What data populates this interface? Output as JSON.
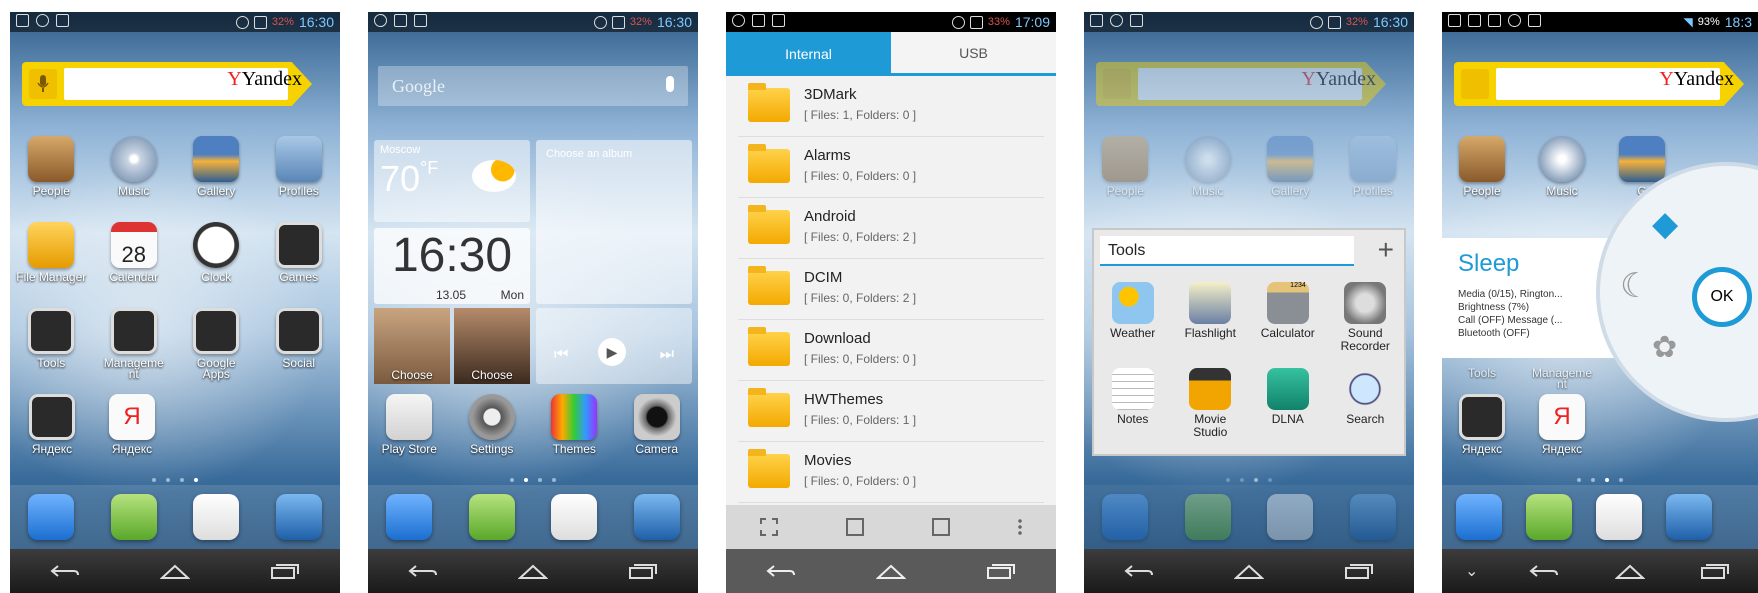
{
  "screens": {
    "s1": {
      "status": {
        "battery_pct": "32%",
        "time": "16:30"
      },
      "yandex_brand": "Yandex",
      "apps_row1": [
        "People",
        "Music",
        "Gallery",
        "Profiles"
      ],
      "apps_row2": [
        "File Manager",
        "Calendar",
        "Clock",
        "Games"
      ],
      "calendar_day": "28",
      "apps_row3": [
        "Tools",
        "Manageme",
        "Google",
        "Social"
      ],
      "apps_row3b": [
        "",
        "nt",
        "Apps",
        ""
      ],
      "apps_row4": [
        "Яндекс",
        "Яндекс"
      ]
    },
    "s2": {
      "status": {
        "battery_pct": "32%",
        "time": "16:30"
      },
      "google_placeholder": "Google",
      "weather_city": "Moscow",
      "weather_temp": "70",
      "weather_unit": "°F",
      "album_label": "Choose an album",
      "clock_time": "16:30",
      "clock_date": "13.05",
      "clock_day": "Mon",
      "choose1": "Choose",
      "choose2": "Choose",
      "apps": [
        "Play Store",
        "Settings",
        "Themes",
        "Camera"
      ]
    },
    "s3": {
      "status": {
        "battery_pct": "33%",
        "time": "17:09"
      },
      "tabs": [
        "Internal",
        "USB"
      ],
      "folders": [
        {
          "name": "3DMark",
          "info": "[ Files: 1, Folders: 0 ]"
        },
        {
          "name": "Alarms",
          "info": "[ Files: 0, Folders: 0 ]"
        },
        {
          "name": "Android",
          "info": "[ Files: 0, Folders: 2 ]"
        },
        {
          "name": "DCIM",
          "info": "[ Files: 0, Folders: 2 ]"
        },
        {
          "name": "Download",
          "info": "[ Files: 0, Folders: 0 ]"
        },
        {
          "name": "HWThemes",
          "info": "[ Files: 0, Folders: 1 ]"
        },
        {
          "name": "Movies",
          "info": "[ Files: 0, Folders: 0 ]"
        }
      ]
    },
    "s4": {
      "status": {
        "battery_pct": "32%",
        "time": "16:30"
      },
      "yandex_brand": "Yandex",
      "bg_apps": [
        "People",
        "Music",
        "Gallery",
        "Profiles"
      ],
      "folder_title": "Tools",
      "folder_apps_row1": [
        "Weather",
        "Flashlight",
        "Calculator",
        "Sound"
      ],
      "folder_apps_row1b": [
        "",
        "",
        "",
        "Recorder"
      ],
      "folder_apps_row2": [
        "Notes",
        "Movie",
        "DLNA",
        "Search"
      ],
      "folder_apps_row2b": [
        "",
        "Studio",
        "",
        ""
      ],
      "calc_display": "1234"
    },
    "s5": {
      "status": {
        "battery_pct": "93%",
        "time": "18:3"
      },
      "yandex_brand": "Yandex",
      "apps_row1": [
        "People",
        "Music",
        "G"
      ],
      "apps_row3": [
        "Tools",
        "Manageme"
      ],
      "apps_row3b": [
        "",
        "nt"
      ],
      "apps_row4": [
        "Яндекс",
        "Яндекс"
      ],
      "sleep_title": "Sleep",
      "sleep_lines": [
        "Media (0/15), Rington...",
        "Brightness (7%)",
        "Call (OFF) Message (...",
        "Bluetooth (OFF)"
      ],
      "ok_label": "OK"
    }
  }
}
